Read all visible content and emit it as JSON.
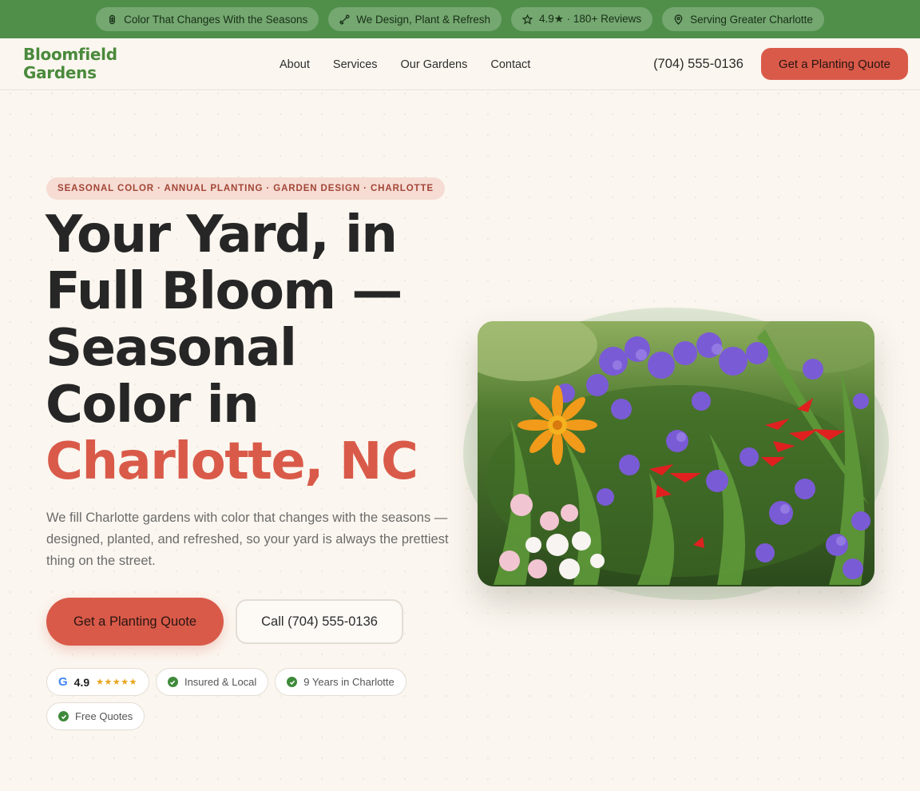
{
  "topbar": {
    "items": [
      {
        "icon": "leaf-icon",
        "label": "Color That Changes With the Seasons"
      },
      {
        "icon": "shovel-icon",
        "label": "We Design, Plant & Refresh"
      },
      {
        "icon": "star-outline-icon",
        "label": "4.9★ · 180+ Reviews"
      },
      {
        "icon": "map-pin-icon",
        "label": "Serving Greater Charlotte"
      }
    ]
  },
  "nav": {
    "logo_line1": "Bloomfield",
    "logo_line2": "Gardens",
    "links": [
      "About",
      "Services",
      "Our Gardens",
      "Contact"
    ],
    "phone": "(704) 555-0136",
    "cta_label": "Get a Planting Quote"
  },
  "hero": {
    "tagline": "SEASONAL COLOR · ANNUAL PLANTING · GARDEN DESIGN · CHARLOTTE",
    "headline": {
      "line1": "Your Yard, in",
      "line2": "Full Bloom —",
      "line3": "Seasonal",
      "line4": "Color in",
      "accent": "Charlotte, NC"
    },
    "lead": "We fill Charlotte gardens with color that changes with the seasons — designed, planted, and refreshed, so your yard is always the prettiest thing on the street.",
    "primary_cta": "Get a Planting Quote",
    "secondary_cta": "Call (704) 555-0136",
    "badges": {
      "google_letter": "G",
      "rating": "4.9",
      "stars": "★★★★★",
      "insured": "Insured & Local",
      "years": "9 Years in Charlotte",
      "free": "Free Quotes"
    }
  },
  "colors": {
    "topbar_green": "#4f8f4a",
    "brand_green": "#4a8a3c",
    "accent_coral": "#d95a49",
    "background_cream": "#fbf6ef"
  }
}
